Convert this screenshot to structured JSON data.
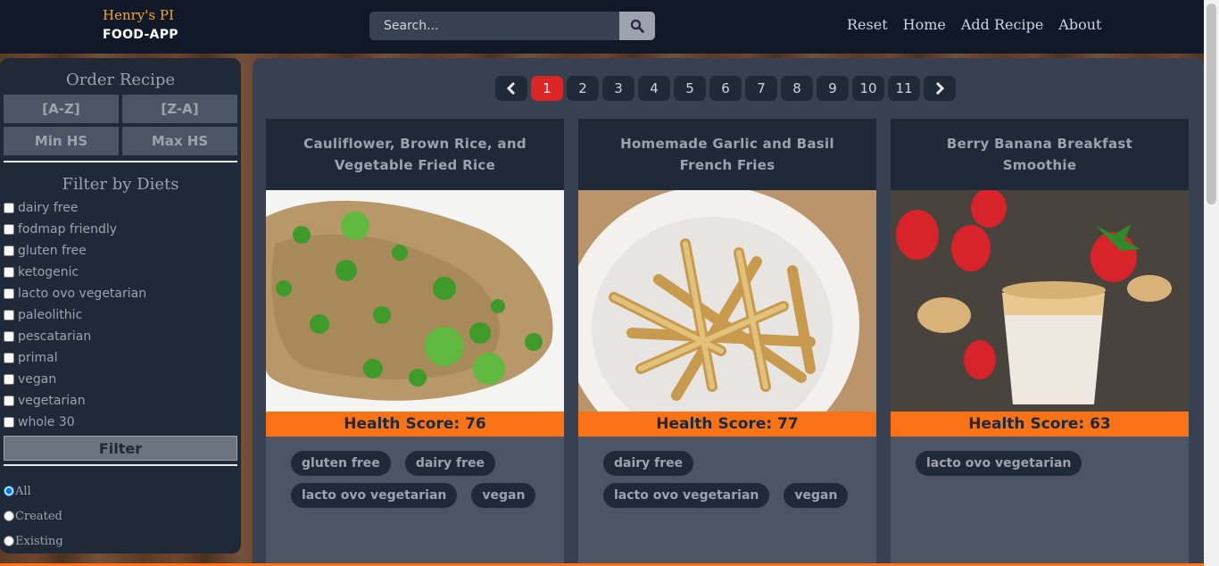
{
  "brand": {
    "top": "Henry's PI",
    "bottom": "FOOD-APP"
  },
  "search": {
    "placeholder": "Search..."
  },
  "nav": [
    "Reset",
    "Home",
    "Add Recipe",
    "About"
  ],
  "sidebar": {
    "order_title": "Order Recipe",
    "order_buttons": [
      "[A-Z]",
      "[Z-A]",
      "Min HS",
      "Max HS"
    ],
    "diet_title": "Filter by Diets",
    "diets": [
      "dairy free",
      "fodmap friendly",
      "gluten free",
      "ketogenic",
      "lacto ovo vegetarian",
      "paleolithic",
      "pescatarian",
      "primal",
      "vegan",
      "vegetarian",
      "whole 30"
    ],
    "filter_button": "Filter",
    "source_options": [
      "All",
      "Created",
      "Existing"
    ],
    "source_selected": "All"
  },
  "pagination": {
    "pages": [
      "1",
      "2",
      "3",
      "4",
      "5",
      "6",
      "7",
      "8",
      "9",
      "10",
      "11"
    ],
    "current": "1"
  },
  "cards": [
    {
      "title": "Cauliflower, Brown Rice, and Vegetable Fried Rice",
      "health_score": "Health Score: 76",
      "diets": [
        "gluten free",
        "dairy free",
        "lacto ovo vegetarian",
        "vegan"
      ],
      "image": "fried-rice-photo"
    },
    {
      "title": "Homemade Garlic and Basil French Fries",
      "health_score": "Health Score: 77",
      "diets": [
        "dairy free",
        "lacto ovo vegetarian",
        "vegan"
      ],
      "image": "french-fries-photo"
    },
    {
      "title": "Berry Banana Breakfast Smoothie",
      "health_score": "Health Score: 63",
      "diets": [
        "lacto ovo vegetarian"
      ],
      "image": "smoothie-photo"
    }
  ],
  "colors": {
    "navbar": "#111827",
    "panel": "#1f2937",
    "accent": "#f97316",
    "active_page": "#dc2626",
    "brand": "#f5a623"
  }
}
